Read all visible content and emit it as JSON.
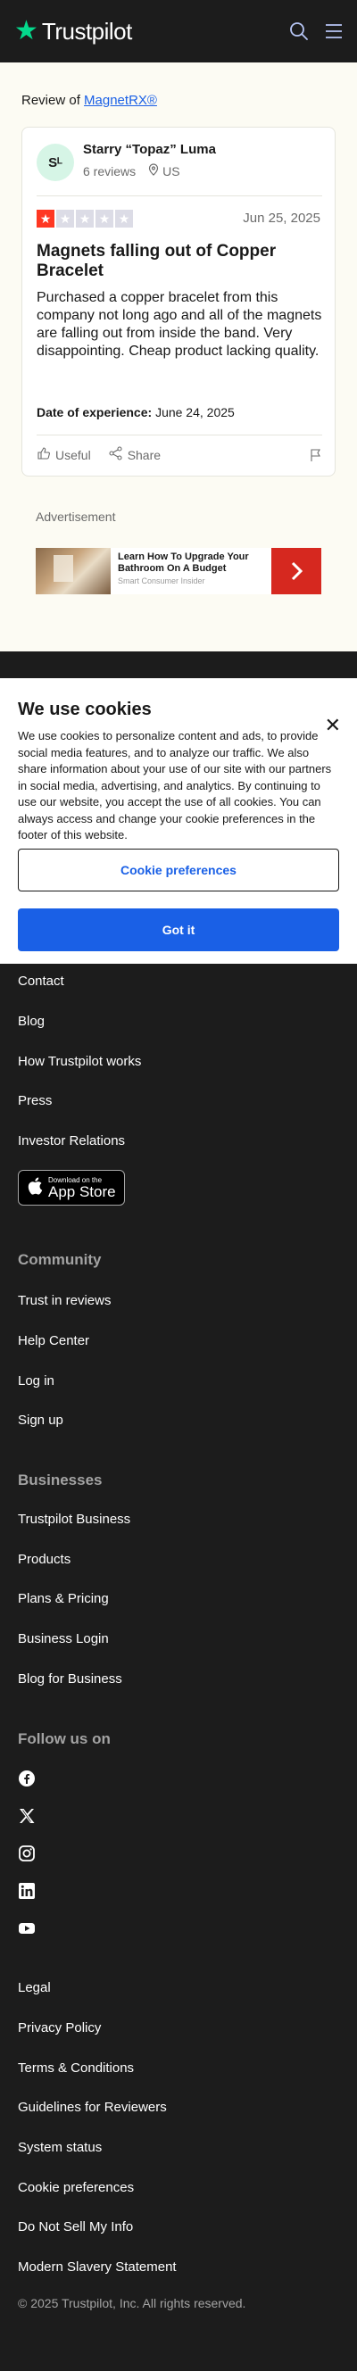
{
  "header": {
    "brand": "Trustpilot",
    "logo_icon": "star-logo-icon",
    "icons": [
      "search-icon",
      "menu-icon"
    ]
  },
  "review_of": {
    "prefix": "Review of ",
    "company": "MagnetRX®"
  },
  "review": {
    "avatar_initials": "Sᴸ",
    "user_name": "Starry “Topaz” Luma",
    "review_count": "6 reviews",
    "country": "US",
    "rating": 1,
    "rating_max": 5,
    "date": "Jun 25, 2025",
    "title": "Magnets falling out of Copper Bracelet",
    "body": "Purchased a copper bracelet from this company not long ago and all of the magnets are falling out from inside the band. Very disappointing. Cheap product lacking quality.",
    "experience_label": "Date of experience:",
    "experience_date": "June 24, 2025",
    "useful_label": "Useful",
    "share_label": "Share"
  },
  "ad": {
    "label": "Advertisement",
    "headline": "Learn How To Upgrade Your Bathroom On A Budget",
    "source": "Smart Consumer Insider"
  },
  "cookies": {
    "title": "We use cookies",
    "text": "We use cookies to personalize content and ads, to provide social media features, and to analyze our traffic. We also share information about your use of our site with our partners in social media, advertising, and analytics. By continuing to use our website, you accept the use of all cookies. You can always access and change your cookie preferences in the footer of this website.",
    "preferences_button": "Cookie preferences",
    "accept_button": "Got it"
  },
  "footer": {
    "about_links": [
      "Contact",
      "Blog",
      "How Trustpilot works",
      "Press",
      "Investor Relations"
    ],
    "app_store": {
      "small": "Download on the",
      "big": "App Store"
    },
    "community": {
      "heading": "Community",
      "links": [
        "Trust in reviews",
        "Help Center",
        "Log in",
        "Sign up"
      ]
    },
    "businesses": {
      "heading": "Businesses",
      "links": [
        "Trustpilot Business",
        "Products",
        "Plans & Pricing",
        "Business Login",
        "Blog for Business"
      ]
    },
    "follow": {
      "heading": "Follow us on",
      "icons": [
        "facebook-icon",
        "x-icon",
        "instagram-icon",
        "linkedin-icon",
        "youtube-icon"
      ]
    },
    "legal_links": [
      "Legal",
      "Privacy Policy",
      "Terms & Conditions",
      "Guidelines for Reviewers",
      "System status",
      "Cookie preferences",
      "Do Not Sell My Info",
      "Modern Slavery Statement"
    ],
    "copyright": "© 2025 Trustpilot, Inc. All rights reserved."
  },
  "colors": {
    "brand_green": "#04da8d",
    "star_red": "#ff3722",
    "link_blue": "#1a60e6",
    "ad_red": "#d6281f"
  }
}
